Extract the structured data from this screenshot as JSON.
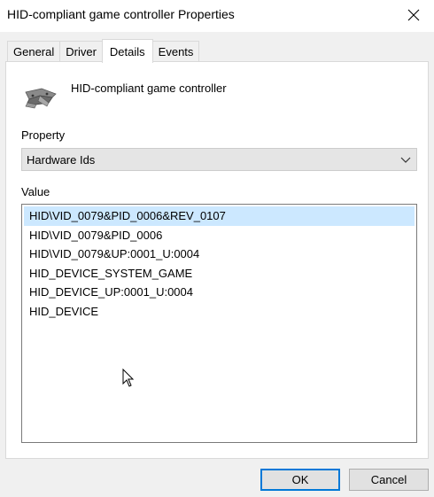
{
  "window": {
    "title": "HID-compliant game controller Properties"
  },
  "tabs": [
    {
      "label": "General",
      "active": false
    },
    {
      "label": "Driver",
      "active": false
    },
    {
      "label": "Details",
      "active": true
    },
    {
      "label": "Events",
      "active": false
    }
  ],
  "device": {
    "name": "HID-compliant game controller",
    "icon": "game-controller-icon"
  },
  "property": {
    "label": "Property",
    "selected": "Hardware Ids"
  },
  "value": {
    "label": "Value",
    "items": [
      "HID\\VID_0079&PID_0006&REV_0107",
      "HID\\VID_0079&PID_0006",
      "HID\\VID_0079&UP:0001_U:0004",
      "HID_DEVICE_SYSTEM_GAME",
      "HID_DEVICE_UP:0001_U:0004",
      "HID_DEVICE"
    ],
    "selected_index": 0
  },
  "buttons": {
    "ok": "OK",
    "cancel": "Cancel"
  },
  "colors": {
    "selection": "#cce8ff",
    "focus_border": "#0078d7",
    "dialog_bg": "#f0f0f0"
  }
}
